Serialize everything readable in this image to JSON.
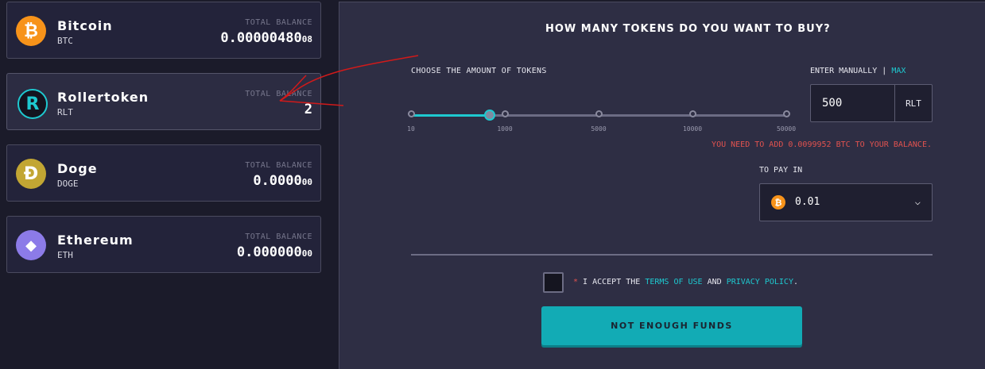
{
  "wallets": [
    {
      "name": "Bitcoin",
      "code": "BTC",
      "balance_label": "Total balance",
      "balance_main": "0.000004",
      "balance_small": "80",
      "balance_tail": "08",
      "icon": "bitcoin-icon",
      "icon_glyph": "₿",
      "color": "#f7931a"
    },
    {
      "name": "Rollertoken",
      "code": "RLT",
      "balance_label": "Total balance",
      "balance_main": "2",
      "icon": "rollertoken-icon",
      "icon_glyph": "R",
      "color": "#1ec9d0"
    },
    {
      "name": "Doge",
      "code": "DOGE",
      "balance_label": "Total balance",
      "balance_main": "0.0000",
      "balance_small": "00",
      "icon": "doge-icon",
      "icon_glyph": "Ð",
      "color": "#c2a633"
    },
    {
      "name": "Ethereum",
      "code": "ETH",
      "balance_label": "Total balance",
      "balance_main": "0.000000",
      "balance_small": "00",
      "icon": "ethereum-icon",
      "icon_glyph": "◆",
      "color": "#8c7be8"
    }
  ],
  "buy": {
    "heading": "How many tokens do you want to buy?",
    "slider_label": "Choose the amount of tokens",
    "slider_ticks": [
      "10",
      "1000",
      "5000",
      "10000",
      "50000"
    ],
    "slider_value_fraction": 0.21,
    "manual_label": "Enter manually | ",
    "max_link": "Max",
    "amount_value": "500",
    "amount_unit": "RLT",
    "warning": "You need to add 0.0099952 BTC to your balance.",
    "pay_label": "To pay in",
    "pay_value": "0.01",
    "accept_prefix": " I accept the ",
    "accept_required": "*",
    "terms_link": "Terms of Use",
    "accept_and": " and ",
    "privacy_link": "Privacy Policy",
    "accept_end": ".",
    "button_label": "Not enough funds"
  },
  "colors": {
    "accent": "#1ec9d0",
    "warning": "#e0524f",
    "button": "#12abb5",
    "annotation": "#d11a1a"
  }
}
